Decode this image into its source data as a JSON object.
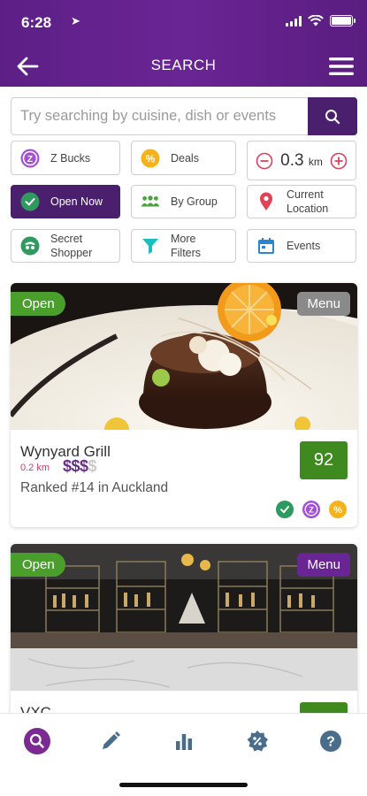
{
  "status_bar": {
    "time": "6:28"
  },
  "header": {
    "title": "SEARCH"
  },
  "search": {
    "placeholder": "Try searching by cuisine, dish or events"
  },
  "filters": {
    "z_bucks": "Z Bucks",
    "deals": "Deals",
    "distance_value": "0.3",
    "distance_unit": "km",
    "open_now": "Open Now",
    "by_group": "By Group",
    "current_location_1": "Current",
    "current_location_2": "Location",
    "secret_shopper_1": "Secret",
    "secret_shopper_2": "Shopper",
    "more_filters_1": "More",
    "more_filters_2": "Filters",
    "events": "Events"
  },
  "restaurants": [
    {
      "status": "Open",
      "menu_label": "Menu",
      "name": "Wynyard Grill",
      "distance": "0.2 km",
      "price_active": "$$$",
      "price_inactive": "$",
      "rank": "Ranked #14 in Auckland",
      "score": "92"
    },
    {
      "status": "Open",
      "menu_label": "Menu",
      "name": "VXC"
    }
  ],
  "colors": {
    "brand_purple": "#4a1f6e",
    "open_green": "#4a9e2c",
    "score_green": "#3f8a1f",
    "deals_orange": "#f6b21a",
    "zbucks_purple": "#a44fd6"
  },
  "icons": {
    "back": "arrow-left-icon",
    "menu": "hamburger-icon",
    "search": "search-icon",
    "nav": [
      "search-icon",
      "pencil-icon",
      "bar-chart-icon",
      "deals-badge-icon",
      "help-icon"
    ]
  }
}
